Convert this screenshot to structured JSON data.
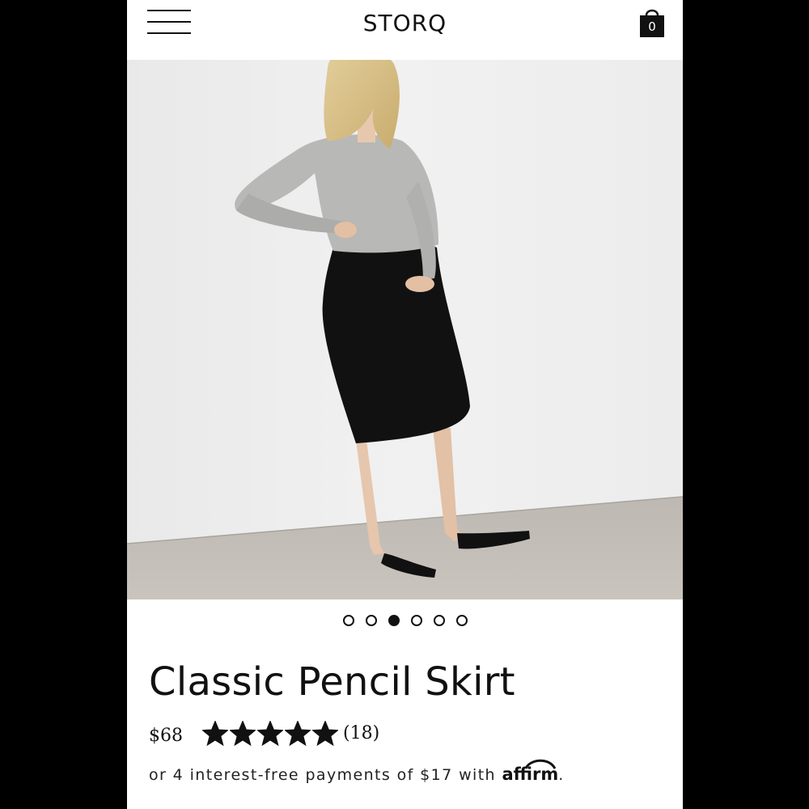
{
  "header": {
    "brand": "STORQ",
    "cart_count": "0"
  },
  "carousel": {
    "total": 6,
    "active_index": 2
  },
  "product": {
    "title": "Classic Pencil Skirt",
    "price": "$68",
    "rating": 5,
    "max_rating": 5,
    "review_count": "(18)",
    "installment_text": "or 4 interest-free payments of $17 with",
    "affirm_brand": "affirm",
    "installment_end": "."
  },
  "colors": {
    "accent": "#111111",
    "background": "#ffffff",
    "page_matte": "#000000"
  },
  "icons": {
    "menu": "hamburger-menu-icon",
    "cart": "shopping-bag-icon",
    "star": "star-icon"
  }
}
